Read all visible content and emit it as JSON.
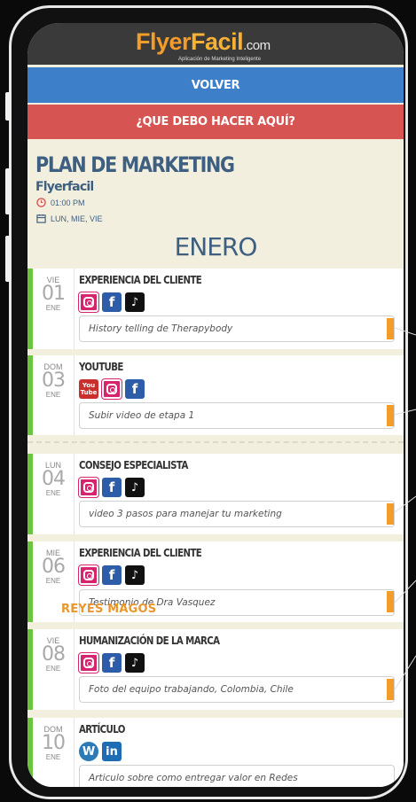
{
  "app": {
    "logo": {
      "part1": "Flyer",
      "part2": "Facil",
      "domain": ".com",
      "tagline": "Aplicación de Marketing Inteligente"
    },
    "back_button": "VOLVER",
    "help_button": "¿QUE DEBO HACER AQUÍ?"
  },
  "plan": {
    "title": "PLAN DE MARKETING",
    "subtitle": "Flyerfacil",
    "time": "01:00 PM",
    "days": "LUN, MIE, VIE",
    "month": "ENERO"
  },
  "colors": {
    "accent_orange": "#f39c2a",
    "blue": "#3d7fc9",
    "red": "#d65451",
    "green": "#6cc33e"
  },
  "events": [
    {
      "dow": "VIE",
      "day": "01",
      "mon": "ENE",
      "title": "EXPERIENCIA DEL CLIENTE",
      "icons": [
        "instagram-icon",
        "facebook-icon",
        "tiktok-icon"
      ],
      "desc": "History telling de Therapybody"
    },
    {
      "dow": "DOM",
      "day": "03",
      "mon": "ENE",
      "title": "YOUTUBE",
      "icons": [
        "youtube-icon",
        "instagram-icon",
        "facebook-icon"
      ],
      "desc": "Subir video de etapa 1"
    },
    {
      "dow": "LUN",
      "day": "04",
      "mon": "ENE",
      "title": "CONSEJO ESPECIALISTA",
      "icons": [
        "instagram-icon",
        "facebook-icon",
        "tiktok-icon"
      ],
      "desc": "video 3 pasos para manejar tu marketing"
    },
    {
      "dow": "MIE",
      "day": "06",
      "mon": "ENE",
      "title": "EXPERIENCIA DEL CLIENTE",
      "icons": [
        "instagram-icon",
        "facebook-icon",
        "tiktok-icon"
      ],
      "desc": "Testimonio de Dra Vasquez",
      "holiday": "REYES MAGOS"
    },
    {
      "dow": "VIE",
      "day": "08",
      "mon": "ENE",
      "title": "HUMANIZACIÓN DE LA MARCA",
      "icons": [
        "instagram-icon",
        "facebook-icon",
        "tiktok-icon"
      ],
      "desc": "Foto del equipo trabajando, Colombia, Chile"
    },
    {
      "dow": "DOM",
      "day": "10",
      "mon": "ENE",
      "title": "ARTÍCULO",
      "icons": [
        "wordpress-icon",
        "linkedin-icon"
      ],
      "desc": "Articulo sobre como entregar valor en Redes"
    }
  ]
}
